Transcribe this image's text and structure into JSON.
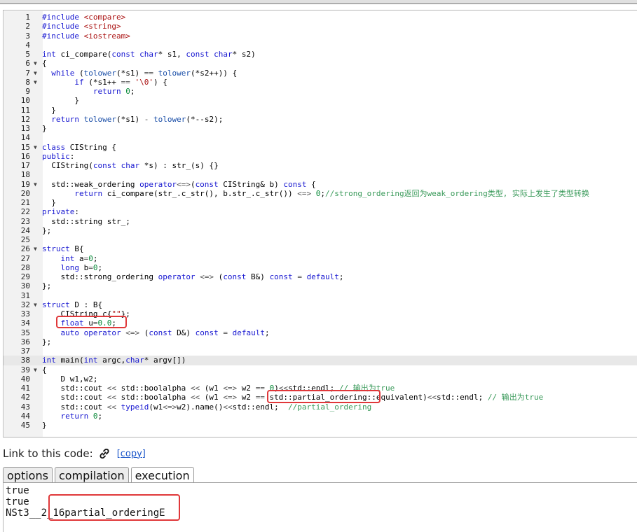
{
  "code_lines": [
    {
      "n": "1",
      "fold": "",
      "html": "<span class=\"k\">#include</span> <span class=\"s\">&lt;compare&gt;</span>"
    },
    {
      "n": "2",
      "fold": "",
      "html": "<span class=\"k\">#include</span> <span class=\"s\">&lt;string&gt;</span>"
    },
    {
      "n": "3",
      "fold": "",
      "html": "<span class=\"k\">#include</span> <span class=\"s\">&lt;iostream&gt;</span>"
    },
    {
      "n": "4",
      "fold": "",
      "html": ""
    },
    {
      "n": "5",
      "fold": "",
      "html": "<span class=\"k\">int</span> ci_compare(<span class=\"k\">const</span> <span class=\"k\">char</span>* s1, <span class=\"k\">const</span> <span class=\"k\">char</span>* s2)"
    },
    {
      "n": "6",
      "fold": "▼",
      "html": "{"
    },
    {
      "n": "7",
      "fold": "▼",
      "html": "  <span class=\"k\">while</span> (<span class=\"f\">tolower</span>(*s1) <span class=\"o\">==</span> <span class=\"f\">tolower</span>(*s2++)) {"
    },
    {
      "n": "8",
      "fold": "▼",
      "html": "       <span class=\"k\">if</span> (*s1++ <span class=\"o\">==</span> <span class=\"s\">'\\0'</span>) {"
    },
    {
      "n": "9",
      "fold": "",
      "html": "           <span class=\"k\">return</span> <span class=\"n\">0</span>;"
    },
    {
      "n": "10",
      "fold": "",
      "html": "       }"
    },
    {
      "n": "11",
      "fold": "",
      "html": "  }"
    },
    {
      "n": "12",
      "fold": "",
      "html": "  <span class=\"k\">return</span> <span class=\"f\">tolower</span>(*s1) <span class=\"o\">-</span> <span class=\"f\">tolower</span>(*--s2);"
    },
    {
      "n": "13",
      "fold": "",
      "html": "}"
    },
    {
      "n": "14",
      "fold": "",
      "html": ""
    },
    {
      "n": "15",
      "fold": "▼",
      "html": "<span class=\"k\">class</span> CIString {"
    },
    {
      "n": "16",
      "fold": "",
      "html": "<span class=\"k\">public</span>:"
    },
    {
      "n": "17",
      "fold": "",
      "html": "  CIString(<span class=\"k\">const</span> <span class=\"k\">char</span> *s) : str_(s) {}"
    },
    {
      "n": "18",
      "fold": "",
      "html": ""
    },
    {
      "n": "19",
      "fold": "▼",
      "html": "  std::weak_ordering <span class=\"k\">operator</span><span class=\"o\">&lt;=&gt;</span>(<span class=\"k\">const</span> CIString&amp; b) <span class=\"k\">const</span> {"
    },
    {
      "n": "20",
      "fold": "",
      "html": "       <span class=\"k\">return</span> ci_compare(str_.c_str(), b.str_.c_str()) <span class=\"o\">&lt;=&gt;</span> <span class=\"n\">0</span>;<span class=\"c\">//strong_ordering返回为weak_ordering类型, 实际上发生了类型转换</span>"
    },
    {
      "n": "21",
      "fold": "",
      "html": "  }"
    },
    {
      "n": "22",
      "fold": "",
      "html": "<span class=\"k\">private</span>:"
    },
    {
      "n": "23",
      "fold": "",
      "html": "  std::string str_;"
    },
    {
      "n": "24",
      "fold": "",
      "html": "};"
    },
    {
      "n": "25",
      "fold": "",
      "html": ""
    },
    {
      "n": "26",
      "fold": "▼",
      "html": "<span class=\"k\">struct</span> B{"
    },
    {
      "n": "27",
      "fold": "",
      "html": "    <span class=\"k\">int</span> a<span class=\"o\">=</span><span class=\"n\">0</span>;"
    },
    {
      "n": "28",
      "fold": "",
      "html": "    <span class=\"k\">long</span> b<span class=\"o\">=</span><span class=\"n\">0</span>;"
    },
    {
      "n": "29",
      "fold": "",
      "html": "    std::strong_ordering <span class=\"k\">operator</span> <span class=\"o\">&lt;=&gt;</span> (<span class=\"k\">const</span> B&amp;) <span class=\"k\">const</span> <span class=\"o\">=</span> <span class=\"k\">default</span>;"
    },
    {
      "n": "30",
      "fold": "",
      "html": "};"
    },
    {
      "n": "31",
      "fold": "",
      "html": ""
    },
    {
      "n": "32",
      "fold": "▼",
      "html": "<span class=\"k\">struct</span> D : B{"
    },
    {
      "n": "33",
      "fold": "",
      "html": "    CIString c{<span class=\"s\">\"\"</span>};"
    },
    {
      "n": "34",
      "fold": "",
      "html": "    <span class=\"k\">float</span> u<span class=\"o\">=</span><span class=\"n\">0.0</span>;"
    },
    {
      "n": "35",
      "fold": "",
      "html": "    <span class=\"k\">auto</span> <span class=\"k\">operator</span> <span class=\"o\">&lt;=&gt;</span> (<span class=\"k\">const</span> D&amp;) <span class=\"k\">const</span> <span class=\"o\">=</span> <span class=\"k\">default</span>;"
    },
    {
      "n": "36",
      "fold": "",
      "html": "};"
    },
    {
      "n": "37",
      "fold": "",
      "html": ""
    },
    {
      "n": "38",
      "fold": "",
      "html": "<span class=\"k\">int</span> main(<span class=\"k\">int</span> argc,<span class=\"k\">char</span>* argv[])"
    },
    {
      "n": "39",
      "fold": "▼",
      "html": "{"
    },
    {
      "n": "40",
      "fold": "",
      "html": "    D w1,w2;"
    },
    {
      "n": "41",
      "fold": "",
      "html": "    std::cout <span class=\"o\">&lt;&lt;</span> std::boolalpha <span class=\"o\">&lt;&lt;</span> (w1 <span class=\"o\">&lt;=&gt;</span> w2 <span class=\"o\">==</span> <span class=\"n\">0</span>)<span class=\"o\">&lt;&lt;</span>std::endl; <span class=\"c\">// 输出为true</span>"
    },
    {
      "n": "42",
      "fold": "",
      "html": "    std::cout <span class=\"o\">&lt;&lt;</span> std::boolalpha <span class=\"o\">&lt;&lt;</span> (w1 <span class=\"o\">&lt;=&gt;</span> w2 <span class=\"o\">==</span> std::partial_ordering::equivalent)<span class=\"o\">&lt;&lt;</span>std::endl; <span class=\"c\">// 输出为true</span>"
    },
    {
      "n": "43",
      "fold": "",
      "html": "    std::cout <span class=\"o\">&lt;&lt;</span> <span class=\"k\">typeid</span>(w1<span class=\"o\">&lt;=&gt;</span>w2).name()<span class=\"o\">&lt;&lt;</span>std::endl;  <span class=\"c\">//partial_ordering</span>"
    },
    {
      "n": "44",
      "fold": "",
      "html": "    <span class=\"k\">return</span> <span class=\"n\">0</span>;"
    },
    {
      "n": "45",
      "fold": "",
      "html": "}"
    }
  ],
  "active_line": "38",
  "link": {
    "label": "Link to this code:",
    "copy": "[copy]"
  },
  "tabs": [
    {
      "label": "options",
      "selected": false
    },
    {
      "label": "compilation",
      "selected": false
    },
    {
      "label": "execution",
      "selected": true
    }
  ],
  "output": [
    "true",
    "true",
    "NSt3__2_16partial_orderingE"
  ],
  "colors": {
    "highlight": "#e0383a",
    "keyword": "#1616d0",
    "link": "#1a55c9"
  }
}
